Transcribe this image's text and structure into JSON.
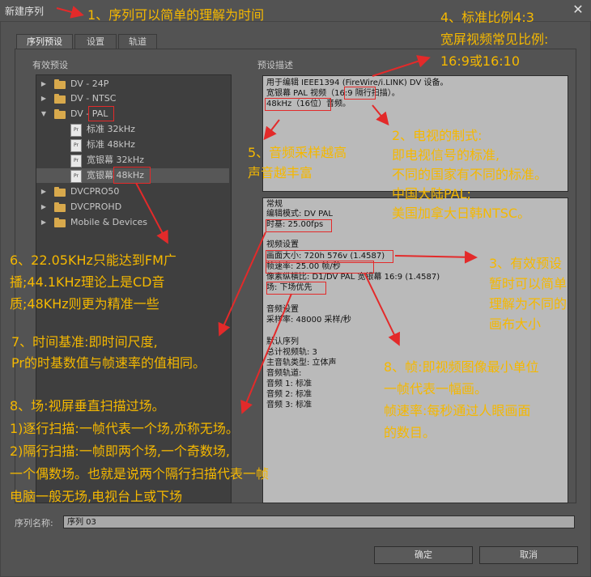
{
  "window": {
    "title": "新建序列",
    "close_glyph": "✕"
  },
  "tabs": [
    {
      "label": "序列预设",
      "active": true
    },
    {
      "label": "设置",
      "active": false
    },
    {
      "label": "轨道",
      "active": false
    }
  ],
  "left_panel": {
    "label": "有效预设"
  },
  "right_panel": {
    "label": "预设描述"
  },
  "tree": [
    {
      "label": "DV - 24P",
      "type": "folder",
      "expanded": false
    },
    {
      "label": "DV - NTSC",
      "type": "folder",
      "expanded": false
    },
    {
      "label": "DV - PAL",
      "type": "folder",
      "expanded": true
    },
    {
      "label": "标准 32kHz",
      "type": "preset"
    },
    {
      "label": "标准 48kHz",
      "type": "preset"
    },
    {
      "label": "宽银幕 32kHz",
      "type": "preset"
    },
    {
      "label": "宽银幕 48kHz",
      "type": "preset",
      "selected": true
    },
    {
      "label": "DVCPRO50",
      "type": "folder",
      "expanded": false
    },
    {
      "label": "DVCPROHD",
      "type": "folder",
      "expanded": false
    },
    {
      "label": "Mobile & Devices",
      "type": "folder",
      "expanded": false
    }
  ],
  "description_top": [
    "用于编辑 IEEE1394 (FireWire/i.LINK) DV 设备。",
    "宽银幕 PAL 视频（16:9 隔行扫描）。",
    "48kHz（16位）音频。"
  ],
  "description_bottom": [
    "常规",
    " 编辑模式: DV PAL",
    "时基: 25.00fps",
    "",
    "视频设置",
    "画面大小: 720h 576v (1.4587)",
    "帧速率: 25.00 帧/秒",
    "像素纵横比: D1/DV PAL 宽银幕 16:9 (1.4587)",
    "场: 下场优先",
    "",
    "音频设置",
    " 采样率: 48000 采样/秒",
    "",
    "默认序列",
    " 总计视频轨: 3",
    " 主音轨类型: 立体声",
    " 音频轨道:",
    " 音频 1: 标准",
    " 音频 2: 标准",
    " 音频 3: 标准"
  ],
  "sequence_name": {
    "label": "序列名称:",
    "value": "序列 03"
  },
  "buttons": {
    "ok": "确定",
    "cancel": "取消"
  },
  "annotations": {
    "a1": "1、序列可以简单的理解为时间",
    "a4": [
      "4、标准比例4:3",
      "宽屏视频常见比例:",
      "16:9或16:10"
    ],
    "a2": [
      "2、电视的制式:",
      "即电视信号的标准,",
      "不同的国家有不同的标准。",
      "中国大陆PAL;",
      "美国加拿大日韩NTSC。"
    ],
    "a5": [
      "5、音频采样越高",
      "声音越丰富"
    ],
    "a3": [
      "3、有效预设",
      "暂时可以简单",
      "理解为不同的",
      "画布大小"
    ],
    "a6": [
      "6、22.05KHz只能达到FM广",
      "播;44.1KHz理论上是CD音",
      "质;48KHz则更为精准一些"
    ],
    "a7": [
      "7、时间基准:即时间尺度,",
      "Pr的时基数值与帧速率的值相同。"
    ],
    "a8a": [
      "8、帧:即视频图像最小单位",
      "一帧代表一幅画。",
      "帧速率:每秒通过人眼画面",
      "的数目。"
    ],
    "a8b": [
      "8、场:视屏垂直扫描过场。",
      "1)逐行扫描:一帧代表一个场,亦称无场。",
      "2)隔行扫描:一帧即两个场,一个奇数场,",
      "一个偶数场。也就是说两个隔行扫描代表一帧",
      "电脑一般无场,电视台上或下场"
    ]
  },
  "colors": {
    "annotation": "#f5b800",
    "highlight": "#e32a2a",
    "folder": "#d8a94c"
  }
}
